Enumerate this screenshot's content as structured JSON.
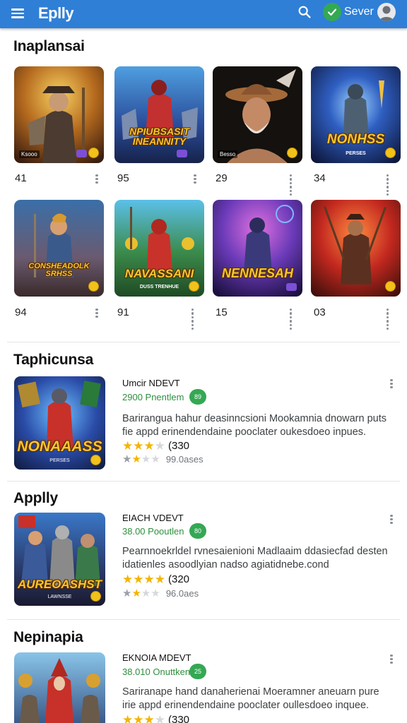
{
  "header": {
    "app_title": "Eplly",
    "save_label": "Sever"
  },
  "grid_section": {
    "title": "Inaplansai",
    "tiles": [
      {
        "count": "41",
        "tag": "Ksooo",
        "logo": "",
        "logo_sub": ""
      },
      {
        "count": "95",
        "tag": "",
        "logo": "NPIUBSASIT INEANNITY",
        "logo_sub": ""
      },
      {
        "count": "29",
        "tag": "Besso",
        "logo": "",
        "logo_sub": ""
      },
      {
        "count": "34",
        "tag": "",
        "logo": "NONHSS",
        "logo_sub": "PERSES"
      },
      {
        "count": "94",
        "tag": "",
        "logo": "CONSHEADOLK SRHSS",
        "logo_sub": ""
      },
      {
        "count": "91",
        "tag": "",
        "logo": "NAVASSANI",
        "logo_sub": "DUSS TRENHUE"
      },
      {
        "count": "15",
        "tag": "",
        "logo": "NENNESAH",
        "logo_sub": ""
      },
      {
        "count": "03",
        "tag": "",
        "logo": "",
        "logo_sub": ""
      }
    ]
  },
  "sections": [
    {
      "title": "Taphicunsa",
      "item_name": "Umcir NDEVT",
      "price": "2900 Pnentlem",
      "price_badge": "89",
      "description": "Barirangua hahur deasinncsioni Mookamnia dnowarn puts fie appd erinendendaine pooclater oukesdoeo inpues.",
      "rating_count": "(330",
      "downloads": "99.0ases",
      "art_logo": "NONAAASS",
      "art_sub": "PERSES"
    },
    {
      "title": "Applly",
      "item_name": "EIACH VDEVT",
      "price": "38.00 Pooutlen",
      "price_badge": "80",
      "description": "Pearnnoekrldel rvnesaienioni Madlaaim ddasiecfad desten idatienles asoodlyian nadso agiatidnebe.cond",
      "rating_count": "(320",
      "downloads": "96.0aes",
      "art_logo": "AUREOASHST",
      "art_sub": "LAWNSSE"
    },
    {
      "title": "Nepinapia",
      "item_name": "EKNOIA MDEVT",
      "price": "38.010 Onuttken",
      "price_badge": "25",
      "description": "Sariranape hand danaherienai Moeramner aneuarn pure irie appd erinendendaine pooclater oullesdoeo inquee.",
      "rating_count": "(330",
      "downloads": "",
      "art_logo": "",
      "art_sub": ""
    }
  ],
  "icons": {
    "menu": "menu-icon",
    "search": "search-icon",
    "save_check": "check-icon",
    "avatar": "avatar-icon",
    "more": "more-vert-icon"
  },
  "colors": {
    "top_bar": "#2f7fd6",
    "price_green": "#2e8f3e",
    "star": "#f4b400"
  }
}
